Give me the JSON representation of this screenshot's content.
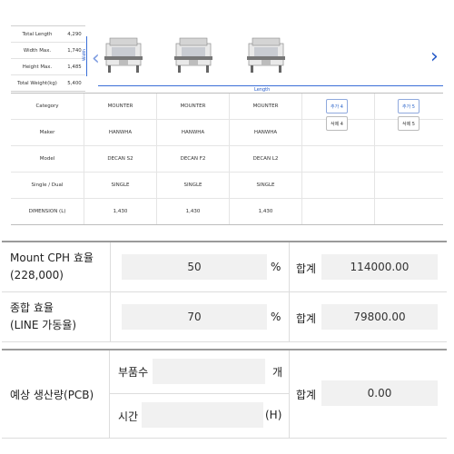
{
  "specs": [
    {
      "label": "Total Length",
      "value": "4,290"
    },
    {
      "label": "Width Max.",
      "value": "1,740"
    },
    {
      "label": "Height Max.",
      "value": "1,485"
    },
    {
      "label": "Total Weight(kg)",
      "value": "5,400"
    }
  ],
  "diagram": {
    "width_label": "Width",
    "length_label": "Length"
  },
  "grid": {
    "rows": [
      {
        "label": "Category",
        "values": [
          "MOUNTER",
          "MOUNTER",
          "MOUNTER"
        ]
      },
      {
        "label": "Maker",
        "values": [
          "HANWHA",
          "HANWHA",
          "HANWHA"
        ]
      },
      {
        "label": "Model",
        "values": [
          "DECAN S2",
          "DECAN F2",
          "DECAN L2"
        ]
      },
      {
        "label": "Single / Dual",
        "values": [
          "SINGLE",
          "SINGLE",
          "SINGLE"
        ]
      },
      {
        "label": "DIMENSION (L)",
        "values": [
          "1,430",
          "1,430",
          "1,430"
        ]
      }
    ],
    "add4": "추가 4",
    "del4": "삭제 4",
    "add5": "추가 5",
    "del5": "삭제 5"
  },
  "efficiency": {
    "mount_label_1": "Mount CPH 효율",
    "mount_label_2": "(228,000)",
    "mount_value": "50",
    "mount_unit": "%",
    "mount_sum_label": "합계",
    "mount_sum": "114000.00",
    "total_label_1": "종합 효율",
    "total_label_2": "(LINE 가동율)",
    "total_value": "70",
    "total_unit": "%",
    "total_sum_label": "합계",
    "total_sum": "79800.00"
  },
  "pcb": {
    "label": "예상 생산량(PCB)",
    "parts_label": "부품수",
    "parts_unit": "개",
    "time_label": "시간",
    "time_unit": "(H)",
    "sum_label": "합계",
    "sum": "0.00"
  },
  "colors": {
    "accent": "#2459c8",
    "input_bg": "#f1f1f1"
  }
}
